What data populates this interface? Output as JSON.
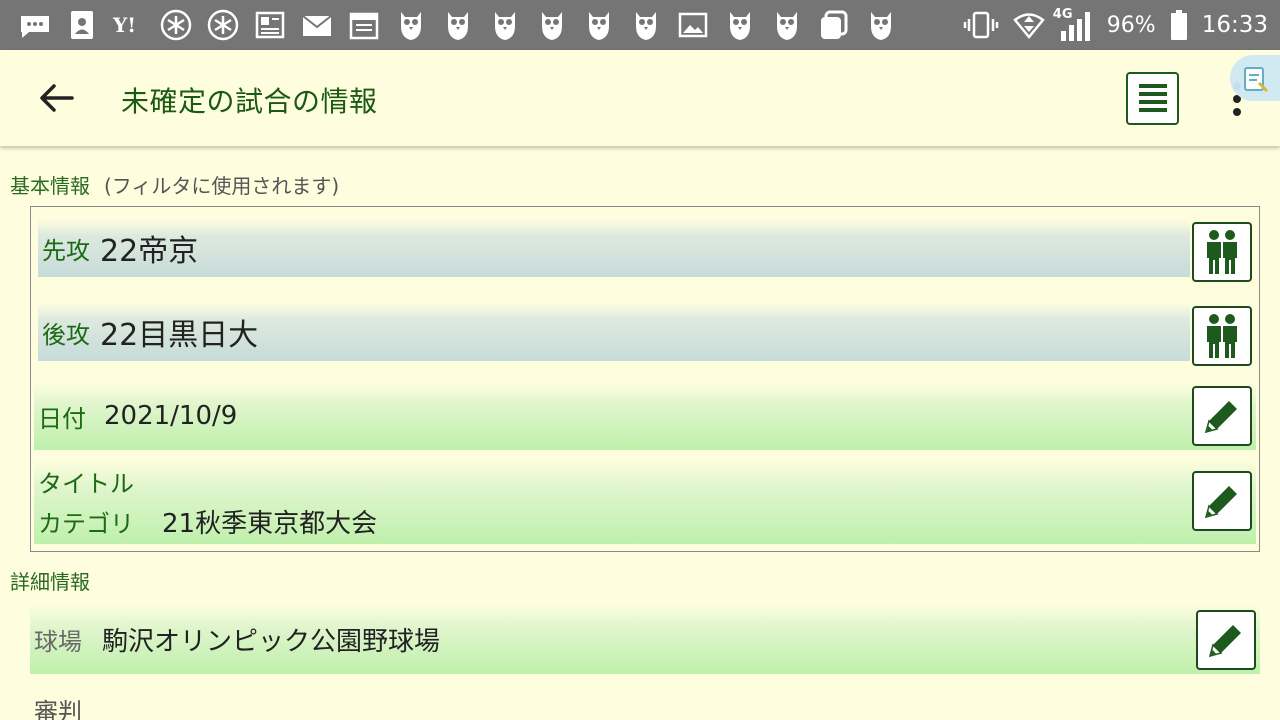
{
  "status_bar": {
    "icons": [
      "message-icon",
      "contacts-icon",
      "yahoo-icon",
      "asterisk-icon",
      "asterisk-icon",
      "news-icon",
      "au-mail-icon",
      "calendar-icon",
      "owl-icon",
      "owl-icon",
      "owl-icon",
      "owl-icon",
      "owl-icon",
      "owl-icon",
      "image-icon",
      "owl-icon",
      "owl-icon",
      "copy-icon",
      "owl-icon"
    ],
    "network": "4G",
    "battery": "96%",
    "time": "16:33"
  },
  "app_bar": {
    "title": "未確定の試合の情報"
  },
  "basic_info": {
    "heading": "基本情報",
    "note": "(フィルタに使用されます)",
    "first_label": "先攻",
    "first_value": "22帝京",
    "second_label": "後攻",
    "second_value": "22目黒日大",
    "date_label": "日付",
    "date_value": "2021/10/9",
    "title_label": "タイトル",
    "category_label": "カテゴリ",
    "category_value": "21秋季東京都大会"
  },
  "detail_info": {
    "heading": "詳細情報",
    "stadium_label": "球場",
    "stadium_value": "駒沢オリンピック公園野球場",
    "umpire_label": "審判"
  },
  "colors": {
    "status_bar": "#757575",
    "background": "#fefedf",
    "accent_green": "#1c6a14"
  }
}
